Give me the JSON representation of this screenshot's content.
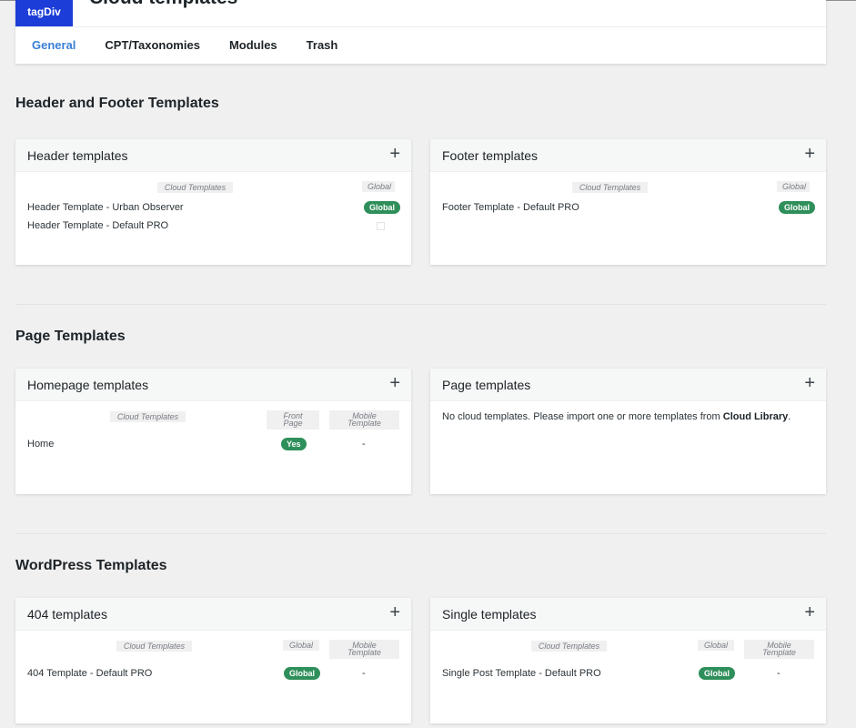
{
  "app": {
    "logo": "tagDiv",
    "title": "Cloud templates"
  },
  "tabs": [
    {
      "label": "General",
      "active": true
    },
    {
      "label": "CPT/Taxonomies",
      "active": false
    },
    {
      "label": "Modules",
      "active": false
    },
    {
      "label": "Trash",
      "active": false
    }
  ],
  "sections": {
    "header_footer": "Header and Footer Templates",
    "page": "Page Templates",
    "wordpress": "WordPress Templates"
  },
  "cards": {
    "header": {
      "title": "Header templates",
      "col_cloud": "Cloud Templates",
      "col_global": "Global",
      "rows": [
        {
          "name": "Header Template - Urban Observer",
          "global": "Global"
        },
        {
          "name": "Header Template - Default PRO",
          "global": ""
        }
      ]
    },
    "footer": {
      "title": "Footer templates",
      "col_cloud": "Cloud Templates",
      "col_global": "Global",
      "rows": [
        {
          "name": "Footer Template - Default PRO",
          "global": "Global"
        }
      ]
    },
    "homepage": {
      "title": "Homepage templates",
      "col_cloud": "Cloud Templates",
      "col_front_1": "Front",
      "col_front_2": "Page",
      "col_mobile_1": "Mobile",
      "col_mobile_2": "Template",
      "rows": [
        {
          "name": "Home",
          "front": "Yes",
          "mobile": "-"
        }
      ]
    },
    "page": {
      "title": "Page templates",
      "empty_text": "No cloud templates. Please import one or more templates from ",
      "empty_link": "Cloud Library",
      "empty_end": "."
    },
    "t404": {
      "title": "404 templates",
      "col_cloud": "Cloud Templates",
      "col_global": "Global",
      "col_mobile_1": "Mobile",
      "col_mobile_2": "Template",
      "rows": [
        {
          "name": "404 Template - Default PRO",
          "global": "Global",
          "mobile": "-"
        }
      ]
    },
    "single": {
      "title": "Single templates",
      "col_cloud": "Cloud Templates",
      "col_global": "Global",
      "col_mobile_1": "Mobile",
      "col_mobile_2": "Template",
      "rows": [
        {
          "name": "Single Post Template - Default PRO",
          "global": "Global",
          "mobile": "-"
        }
      ]
    }
  },
  "icons": {
    "add": "plus-icon"
  },
  "colors": {
    "accent": "#3a7fd5",
    "logo_bg": "#1c3dd8",
    "badge": "#2f8f5b"
  }
}
